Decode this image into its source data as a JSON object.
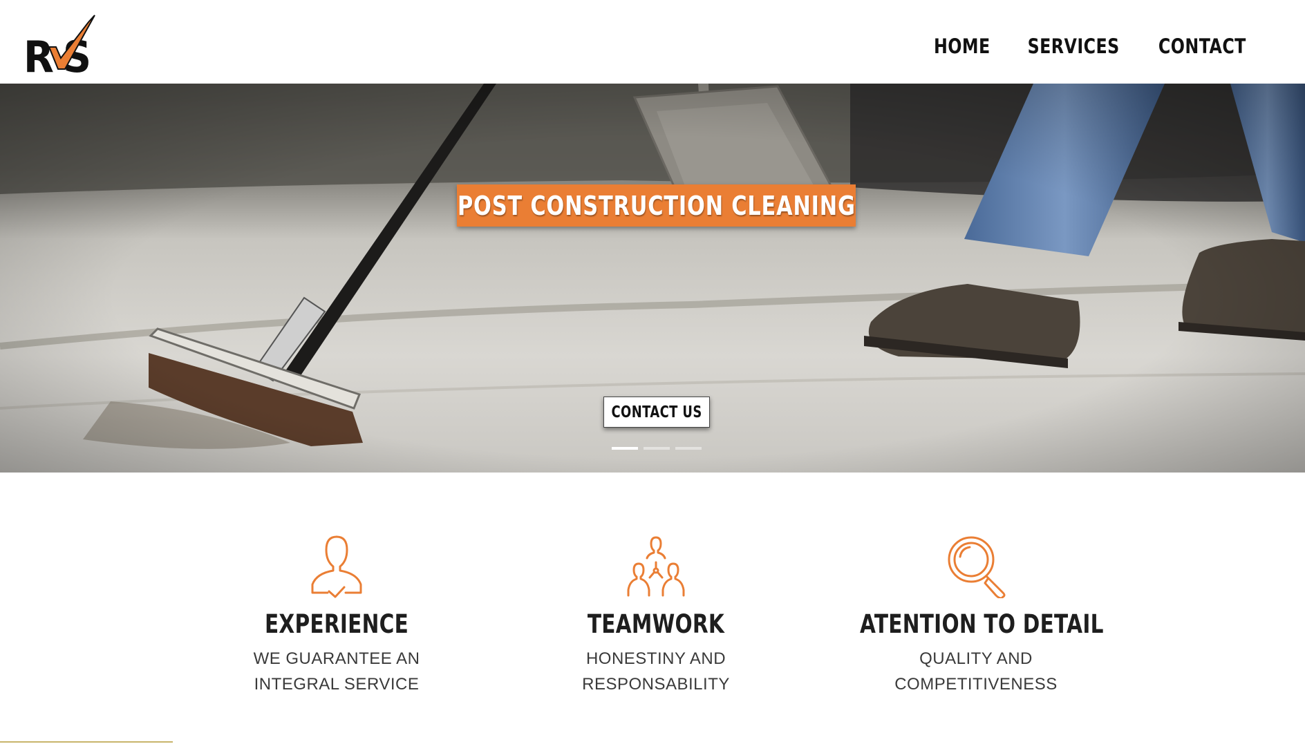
{
  "brand": {
    "logo_text_left": "R",
    "logo_text_right": "S",
    "accent_color": "#ea7e34"
  },
  "nav": {
    "home": "HOME",
    "services": "SERVICES",
    "contact": "CONTACT"
  },
  "hero": {
    "title": "POST CONSTRUCTION CLEANING",
    "button": "CONTACT US",
    "slides_total": 3,
    "active_slide": 1
  },
  "features": [
    {
      "icon": "person-check-icon",
      "title": "EXPERIENCE",
      "line1": "WE GUARANTEE AN",
      "line2": "INTEGRAL SERVICE"
    },
    {
      "icon": "team-icon",
      "title": "TEAMWORK",
      "line1": "HONESTINY AND",
      "line2": "RESPONSABILITY"
    },
    {
      "icon": "magnifier-icon",
      "title": "ATENTION TO DETAIL",
      "line1": "QUALITY AND",
      "line2": "COMPETITIVENESS"
    }
  ]
}
